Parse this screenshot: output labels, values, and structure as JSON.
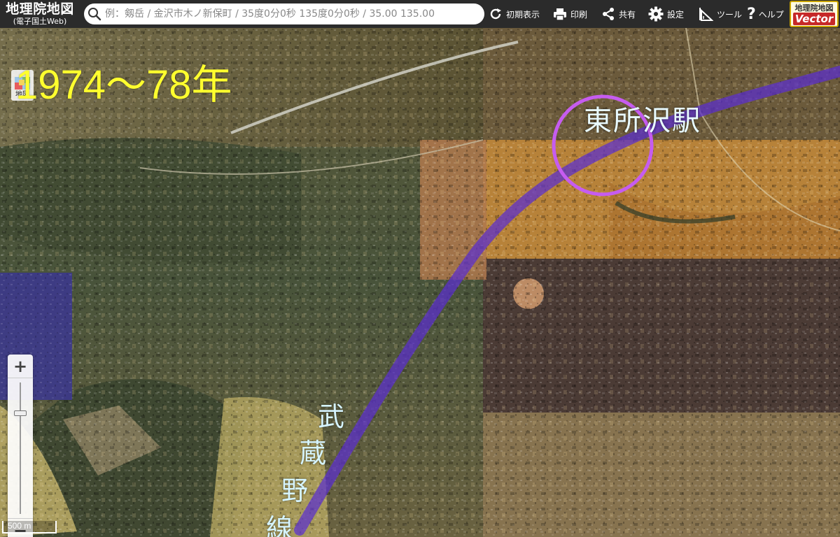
{
  "header": {
    "logo_main": "地理院地図",
    "logo_sub": "(電子国土Web)",
    "search_placeholder": "例：剱岳 / 金沢市木ノ新保町 / 35度0分0秒 135度0分0秒 / 35.00 135.00",
    "tools": {
      "reset": "初期表示",
      "print": "印刷",
      "share": "共有",
      "settings": "設定",
      "tools": "ツール",
      "help": "ヘルプ"
    },
    "vector_top": "地理院地図",
    "vector_bottom": "Vector"
  },
  "map": {
    "layer_button_label": "地図",
    "year_label": "1974〜78年",
    "station_label": "東所沢駅",
    "line_label_chars": [
      "武",
      "蔵",
      "野",
      "線"
    ],
    "scale_label": "500 m",
    "colors": {
      "route_line": "#5a2ecf",
      "station_circle": "#c65cf0",
      "year_text": "#ffff2e",
      "annotation_text": "#d6f4ff"
    }
  },
  "zoom": {
    "in_label": "+",
    "out_label": "−"
  }
}
